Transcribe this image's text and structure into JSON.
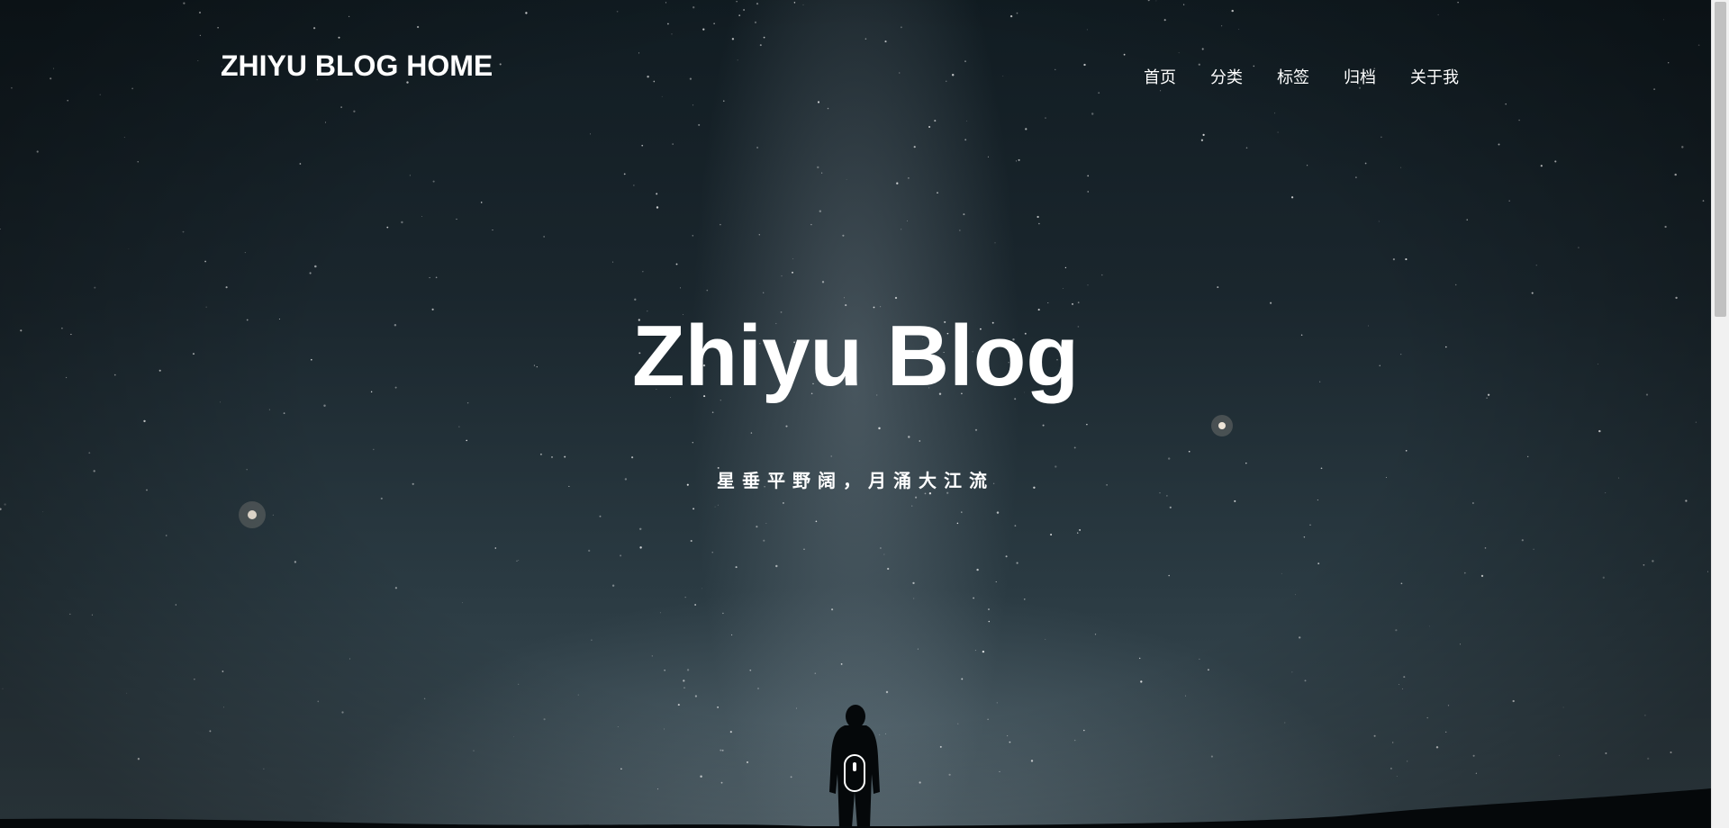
{
  "header": {
    "brand": "ZHIYU BLOG HOME"
  },
  "nav": {
    "items": [
      {
        "label": "首页"
      },
      {
        "label": "分类"
      },
      {
        "label": "标签"
      },
      {
        "label": "归档"
      },
      {
        "label": "关于我"
      }
    ]
  },
  "hero": {
    "title": "Zhiyu Blog",
    "subtitle": "星垂平野阔，月涌大江流"
  },
  "icons": {
    "scroll_indicator": "mouse-scroll-icon"
  },
  "colors": {
    "text": "#ffffff",
    "sky_top": "#111c22",
    "sky_bottom": "#3d4d55",
    "scrollbar_track": "#f1f1f1",
    "scrollbar_thumb": "#c1c1c1"
  }
}
